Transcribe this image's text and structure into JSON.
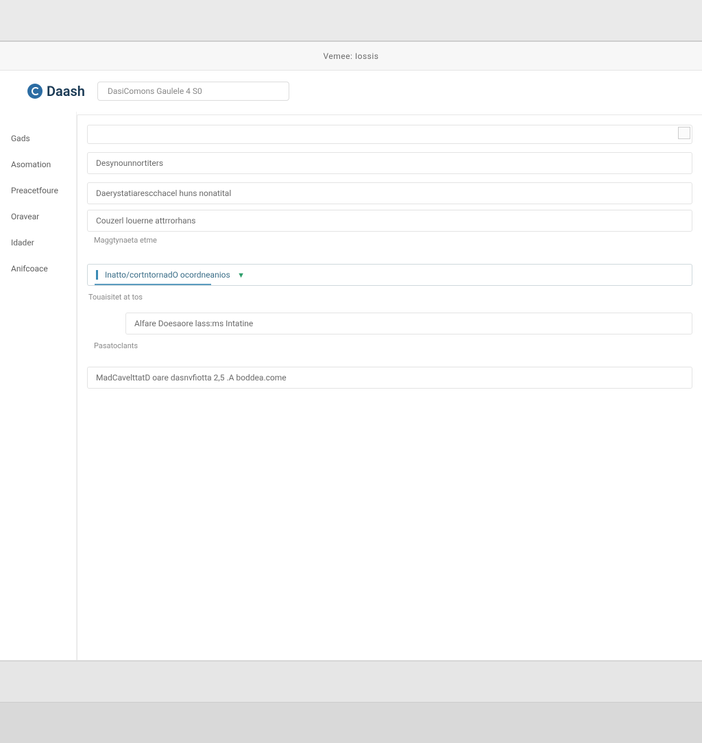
{
  "window": {
    "title": "Vemee: Iossis"
  },
  "header": {
    "brand": "Daash",
    "breadcrumb": "DasiComons  Gaulele   4 S0"
  },
  "sidebar": {
    "items": [
      {
        "label": "Gads"
      },
      {
        "label": "Asomation"
      },
      {
        "label": "Preacetfoure"
      },
      {
        "label": "Oravear"
      },
      {
        "label": "Idader"
      },
      {
        "label": "Anifcoace"
      }
    ]
  },
  "form": {
    "field_top_has_corner": true,
    "field1": "Desynounnortiters",
    "field2": "Daerystatiarescchacel huns nonatital",
    "field3": "Couzerl louerne attrrorhans",
    "caption1": "Maggtynaeta etme",
    "select_value": "Inatto/cortntornadO ocordneanios",
    "caption2": "Touaisitet at tos",
    "sub_field": "Alfare Doesaore lass:ms Intatine",
    "caption3": "Pasatoclants",
    "field_last": "MadCavelttatD oare dasnvfiotta 2,5 .A boddea.come"
  }
}
